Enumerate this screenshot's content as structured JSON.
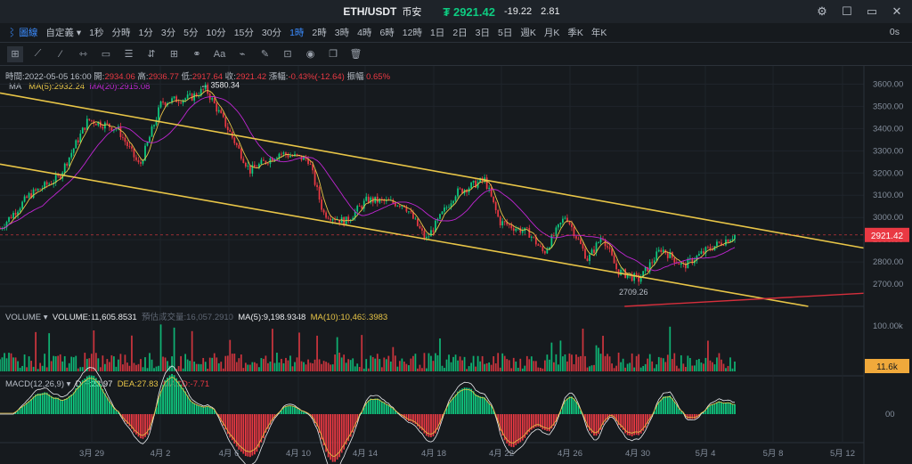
{
  "header": {
    "pair": "ETH/USDT",
    "exchange": "币安",
    "price_symbol": "₮",
    "price": "2921.42",
    "change": "-19.22",
    "change_pct": "2.81",
    "controls": [
      "⚙",
      "☐",
      "▭",
      "✕"
    ]
  },
  "toolbar": {
    "chart_label": "圖線",
    "custom_label": "自定義",
    "intervals": [
      "1秒",
      "分時",
      "1分",
      "3分",
      "5分",
      "10分",
      "15分",
      "30分",
      "1時",
      "2時",
      "3時",
      "4時",
      "6時",
      "12時",
      "1日",
      "2日",
      "3日",
      "5日",
      "週K",
      "月K",
      "季K",
      "年K"
    ],
    "active_interval": "1時",
    "right_label": "0s"
  },
  "draw_tools": [
    "cursor-icon",
    "crosshair-icon",
    "trend-line-icon",
    "horizontal-line-icon",
    "parallel-channel-icon",
    "fib-icon",
    "rectangle-icon",
    "add-indicator-icon",
    "brush-icon",
    "text-icon",
    "magnet-icon",
    "pencil-icon",
    "lock-icon",
    "eye-icon",
    "clone-icon",
    "delete-icon"
  ],
  "info": {
    "time_label": "時間:",
    "time": "2022-05-05 16:00",
    "open_label": "開:",
    "open": "2934.06",
    "high_label": "高:",
    "high": "2936.77",
    "low_label": "低:",
    "low": "2917.64",
    "close_label": "收:",
    "close": "2921.42",
    "chg_label": "漲幅:",
    "chg": "-0.43%(-12.64)",
    "amp_label": "振幅:",
    "amp": "0.65%"
  },
  "ma": {
    "label": "MA",
    "ma5": "MA(5):2932.24",
    "ma20": "MA(20):2915.08"
  },
  "volume_legend": {
    "label": "VOLUME",
    "volume": "VOLUME:11,605.8531",
    "forecast": "預估成交量:16,057.2910",
    "ma5": "MA(5):9,198.9348",
    "ma10": "MA(10):10,463.3983"
  },
  "macd_legend": {
    "label": "MACD(12,26,9)",
    "dif": "DIF:23.97",
    "dea": "DEA:27.83",
    "macd": "MACD:-7.71"
  },
  "price_axis": {
    "ticks": [
      "3600.00",
      "3500.00",
      "3400.00",
      "3300.00",
      "3200.00",
      "3100.00",
      "3000.00",
      "2900.00",
      "2800.00",
      "2700.00"
    ],
    "current": "2921.42"
  },
  "volume_axis": {
    "ticks": [
      "100.00k"
    ],
    "current": "11.6k"
  },
  "macd_axis": {
    "ticks": [
      "00"
    ]
  },
  "time_axis": {
    "ticks": [
      "3月 29",
      "4月 2",
      "4月 6",
      "4月 10",
      "4月 14",
      "4月 18",
      "4月 22",
      "4月 26",
      "4月 30",
      "5月 4",
      "5月 8",
      "5月 12"
    ]
  },
  "annotations": {
    "high": "← 3580.34",
    "low": "2709.26"
  },
  "colors": {
    "up": "#0ecb81",
    "down": "#ea3943",
    "ma5": "#e8c547",
    "ma20": "#c026d3",
    "trend": "#e8c547",
    "accent": "#3b8cff",
    "red_line": "#d62f3c"
  },
  "chart_data": {
    "type": "candlestick",
    "timeframe": "1h",
    "y_range": [
      2600,
      3650
    ],
    "anchor_prices": [
      {
        "t": 0,
        "p": 2950
      },
      {
        "t": 0.04,
        "p": 3100
      },
      {
        "t": 0.08,
        "p": 3180
      },
      {
        "t": 0.12,
        "p": 3440
      },
      {
        "t": 0.16,
        "p": 3400
      },
      {
        "t": 0.19,
        "p": 3230
      },
      {
        "t": 0.22,
        "p": 3520
      },
      {
        "t": 0.26,
        "p": 3540
      },
      {
        "t": 0.28,
        "p": 3580
      },
      {
        "t": 0.31,
        "p": 3400
      },
      {
        "t": 0.34,
        "p": 3210
      },
      {
        "t": 0.38,
        "p": 3290
      },
      {
        "t": 0.42,
        "p": 3260
      },
      {
        "t": 0.44,
        "p": 3020
      },
      {
        "t": 0.47,
        "p": 2980
      },
      {
        "t": 0.5,
        "p": 3080
      },
      {
        "t": 0.55,
        "p": 3060
      },
      {
        "t": 0.58,
        "p": 2900
      },
      {
        "t": 0.62,
        "p": 3110
      },
      {
        "t": 0.66,
        "p": 3170
      },
      {
        "t": 0.68,
        "p": 2980
      },
      {
        "t": 0.72,
        "p": 2930
      },
      {
        "t": 0.74,
        "p": 2840
      },
      {
        "t": 0.77,
        "p": 3010
      },
      {
        "t": 0.8,
        "p": 2810
      },
      {
        "t": 0.82,
        "p": 2920
      },
      {
        "t": 0.84,
        "p": 2760
      },
      {
        "t": 0.87,
        "p": 2720
      },
      {
        "t": 0.9,
        "p": 2860
      },
      {
        "t": 0.93,
        "p": 2780
      },
      {
        "t": 0.96,
        "p": 2850
      },
      {
        "t": 1.0,
        "p": 2921
      }
    ],
    "channel_upper": [
      {
        "t": 0,
        "p": 3560
      },
      {
        "t": 1.18,
        "p": 2860
      }
    ],
    "channel_lower": [
      {
        "t": 0,
        "p": 3240
      },
      {
        "t": 1.1,
        "p": 2600
      }
    ],
    "red_line": [
      {
        "t": 0.85,
        "p": 2600
      },
      {
        "t": 1.18,
        "p": 2660
      }
    ]
  }
}
